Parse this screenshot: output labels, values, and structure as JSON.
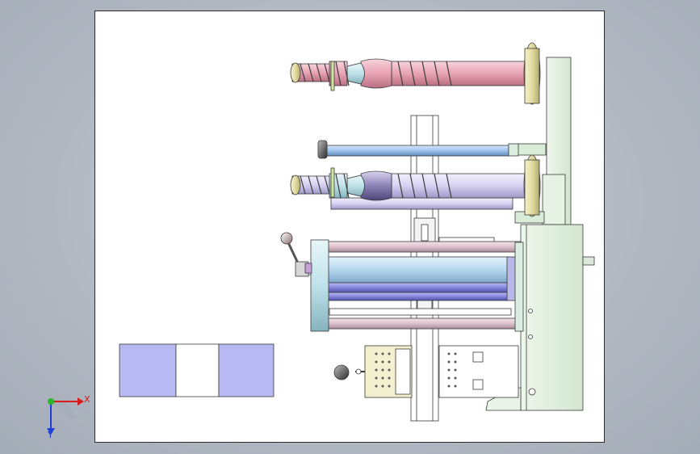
{
  "viewport": {
    "background": "#b8bfc8"
  },
  "triad": {
    "x_label": "X",
    "y_label": "Y"
  },
  "colors": {
    "screw_pink": "#e8a3b4",
    "rod_blue": "#9fc3ea",
    "frame_green": "#dfeedd",
    "flange_olive": "#e6e0a8",
    "collar_cyan": "#bfe2ea",
    "roller_lavender": "#c9c3f0",
    "roller_blue": "#8c8ce0",
    "guide_pink": "#dcc1cc",
    "block_lavender": "#b8b8f2",
    "panel_cream": "#f3f0cf"
  },
  "icons": [
    "axis-triad-icon",
    "rotation-handle-icon",
    "knob-icon"
  ]
}
